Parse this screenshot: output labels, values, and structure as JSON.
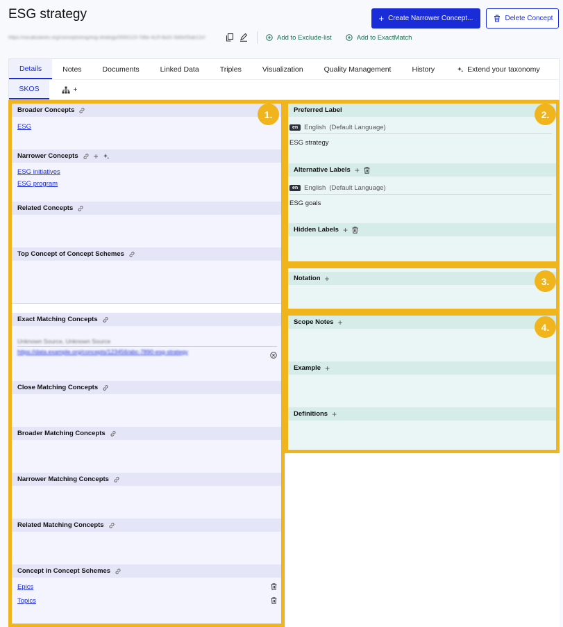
{
  "header": {
    "title": "ESG strategy",
    "url": "https://vocabularies.org/concepts/esg/esg-strategy/0000123-7d6e-4c2f-8a31-9d0e55ab12cf",
    "create_label": "Create Narrower Concept...",
    "delete_label": "Delete Concept",
    "exclude_label": "Add to Exclude-list",
    "exactmatch_label": "Add to ExactMatch"
  },
  "tabs": [
    {
      "label": "Details"
    },
    {
      "label": "Notes"
    },
    {
      "label": "Documents"
    },
    {
      "label": "Linked Data"
    },
    {
      "label": "Triples"
    },
    {
      "label": "Visualization"
    },
    {
      "label": "Quality Management"
    },
    {
      "label": "History"
    },
    {
      "label": "Extend your taxonomy"
    }
  ],
  "subtabs": {
    "skos": "SKOS",
    "plus": "+"
  },
  "badges": [
    "1.",
    "2.",
    "3.",
    "4."
  ],
  "left": {
    "broader": {
      "title": "Broader Concepts",
      "items": [
        "ESG"
      ]
    },
    "narrower": {
      "title": "Narrower Concepts",
      "items": [
        "ESG initiatives",
        "ESG program"
      ]
    },
    "related": {
      "title": "Related Concepts"
    },
    "topconcept": {
      "title": "Top Concept of Concept Schemes"
    },
    "exact": {
      "title": "Exact Matching Concepts",
      "item_label": "Unknown Source, Unknown Source",
      "item_url": "https://data.example.org/concepts/123456/abc-7890-esg-strategy"
    },
    "close": {
      "title": "Close Matching Concepts"
    },
    "broadermatch": {
      "title": "Broader Matching Concepts"
    },
    "narrowermatch": {
      "title": "Narrower Matching Concepts"
    },
    "relatedmatch": {
      "title": "Related Matching Concepts"
    },
    "inscheme": {
      "title": "Concept in Concept Schemes",
      "items": [
        "Epics",
        "Topics"
      ]
    }
  },
  "right": {
    "preferred": {
      "title": "Preferred Label",
      "lang_tag": "en",
      "lang": "English",
      "default": "(Default Language)",
      "value": "ESG strategy"
    },
    "alternative": {
      "title": "Alternative Labels",
      "lang_tag": "en",
      "lang": "English",
      "default": "(Default Language)",
      "value": "ESG goals"
    },
    "hidden": {
      "title": "Hidden Labels"
    },
    "notation": {
      "title": "Notation"
    },
    "scope": {
      "title": "Scope Notes"
    },
    "example": {
      "title": "Example"
    },
    "definitions": {
      "title": "Definitions"
    }
  },
  "colors": {
    "accent": "#1a2bd8",
    "highlight": "#f0b41c",
    "green": "#1c6d4f"
  }
}
